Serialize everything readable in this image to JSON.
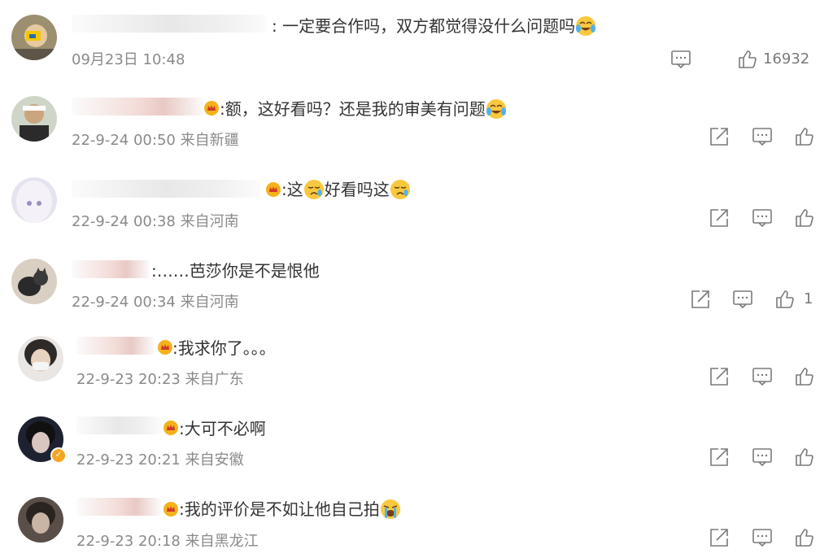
{
  "comments": [
    {
      "text": "一定要合作吗，双方都觉得没什么问题吗",
      "date": "09月23日 10:48",
      "likes": "16932"
    },
    {
      "text": "额，这好看吗？还是我的审美有问题",
      "date": "22-9-24 00:50 来自新疆",
      "likes": ""
    },
    {
      "text_a": "这",
      "text_b": "好看吗这",
      "date": "22-9-24 00:38 来自河南",
      "likes": ""
    },
    {
      "text": "……芭莎你是不是恨他",
      "date": "22-9-24 00:34 来自河南",
      "likes": "1"
    },
    {
      "text": "我求你了。。。",
      "date": "22-9-23 20:23 来自广东",
      "likes": ""
    },
    {
      "text": "大可不必啊",
      "date": "22-9-23 20:21 来自安徽",
      "likes": ""
    },
    {
      "text": "我的评价是不如让他自己拍",
      "date": "22-9-23 20:18 来自黑龙江",
      "likes": ""
    }
  ],
  "colon": ":",
  "icons": {
    "share": "share-icon",
    "comment": "comment-icon",
    "like": "like-icon",
    "crown": "crown-badge-icon",
    "verified": "verified-icon"
  },
  "colors": {
    "text": "#333333",
    "meta": "#8a8a8a",
    "icon": "#7a7a7a",
    "badge": "#f5a623"
  }
}
